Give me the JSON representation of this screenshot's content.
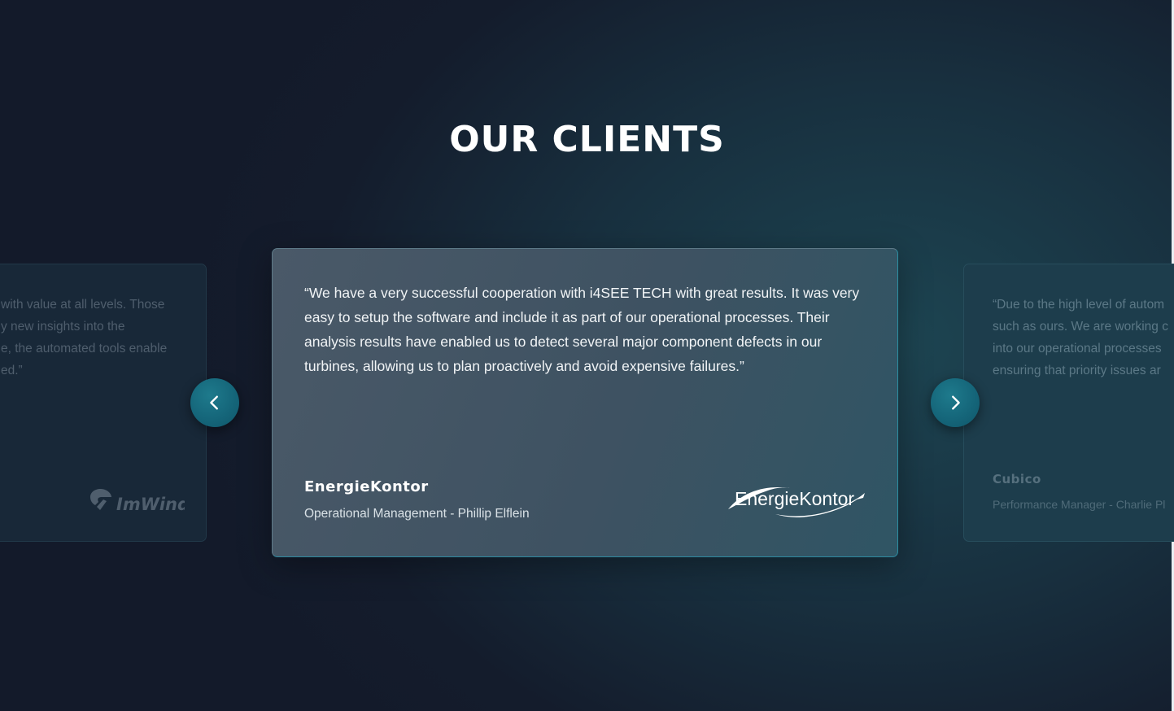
{
  "section": {
    "title": "OUR CLIENTS"
  },
  "testimonials": [
    {
      "position": "previous",
      "quote_lines": [
        "with value at all levels. Those",
        "y new insights into the",
        "e, the automated tools enable",
        "ed.”"
      ],
      "logo_text": "ImWind",
      "logo_icon": "wind-logo-icon"
    },
    {
      "position": "current",
      "quote": "“We have a very successful cooperation with i4SEE TECH with great results. It was very easy to setup the software and include it as part of our operational processes. Their analysis results have enabled us to detect several major component defects in our turbines, allowing us to plan proactively and avoid expensive failures.”",
      "client": "EnergieKontor",
      "role": "Operational Management - Phillip Elflein",
      "logo_text": "EnergieKontor"
    },
    {
      "position": "next",
      "quote_lines": [
        "“Due to the high level of autom",
        "such as ours. We are working c",
        "into our operational processes",
        "ensuring that priority issues ar"
      ],
      "client": "Cubico",
      "role": "Performance Manager - Charlie Pl"
    }
  ],
  "navigation": {
    "prev_icon": "chevron-left-icon",
    "next_icon": "chevron-right-icon"
  },
  "colors": {
    "accent": "#15667a",
    "background": "#141c2c",
    "card_border_accent": "#2a8ea2"
  }
}
